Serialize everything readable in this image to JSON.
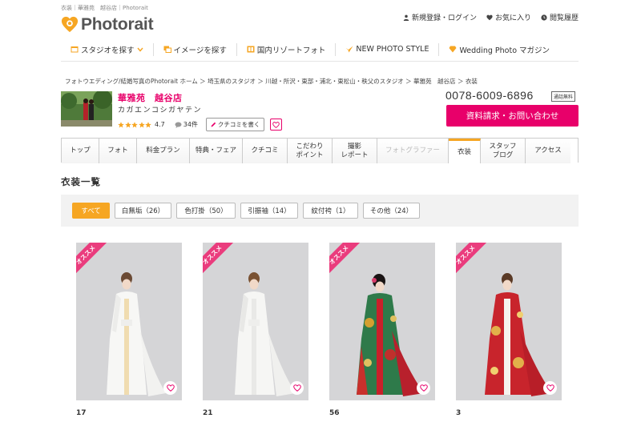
{
  "header": {
    "topline": "衣装｜華雅苑　越谷店｜Photorait",
    "logo_text": "Photorait",
    "util": [
      {
        "label": "新規登録・ログイン",
        "icon": "user-icon"
      },
      {
        "label": "お気に入り",
        "icon": "heart-icon"
      },
      {
        "label": "閲覧履歴",
        "icon": "clock-icon"
      }
    ]
  },
  "gnav": [
    {
      "label": "スタジオを探す",
      "icon": "calendar-icon",
      "has_dropdown": true
    },
    {
      "label": "イメージを探す",
      "icon": "images-icon"
    },
    {
      "label": "国内リゾートフォト",
      "icon": "book-icon"
    },
    {
      "label": "NEW PHOTO STYLE",
      "icon": "bird-icon"
    },
    {
      "label": "Wedding Photo マガジン",
      "icon": "diamond-icon"
    }
  ],
  "breadcrumb": "フォトウエディング/結婚写真のPhotorait ホーム ＞ 埼玉県のスタジオ ＞ 川越・所沢・東部・浦北・東松山・秩父のスタジオ ＞ 華雅苑　越谷店 ＞ 衣装",
  "studio": {
    "name": "華雅苑　越谷店",
    "kana": "カガエンコシガヤテン",
    "rating": "4.7",
    "reviews": "34件",
    "review_button": "クチコミを書く",
    "phone": "0078-6009-6896",
    "free_badge": "通話無料",
    "cta": "資料請求・お問い合わせ"
  },
  "tabs": [
    "トップ",
    "フォト",
    "料金プラン",
    "特典・フェア",
    "クチコミ",
    "こだわり\nポイント",
    "撮影\nレポート",
    "フォトグラファー",
    "衣装",
    "スタッフ\nブログ",
    "アクセス"
  ],
  "section_title": "衣装一覧",
  "filters": [
    "すべて",
    "白無垢（26）",
    "色打掛（50）",
    "引振袖（14）",
    "紋付袴（1）",
    "その他（24）"
  ],
  "cards": [
    {
      "ribbon": "オススメ",
      "number": "17"
    },
    {
      "ribbon": "オススメ",
      "number": "21"
    },
    {
      "ribbon": "オススメ",
      "number": "56"
    },
    {
      "ribbon": "オススメ",
      "number": "3"
    }
  ],
  "colors": {
    "pink": "#e8006a",
    "orange": "#f6a623",
    "ribbon": "#ea3c7d"
  }
}
